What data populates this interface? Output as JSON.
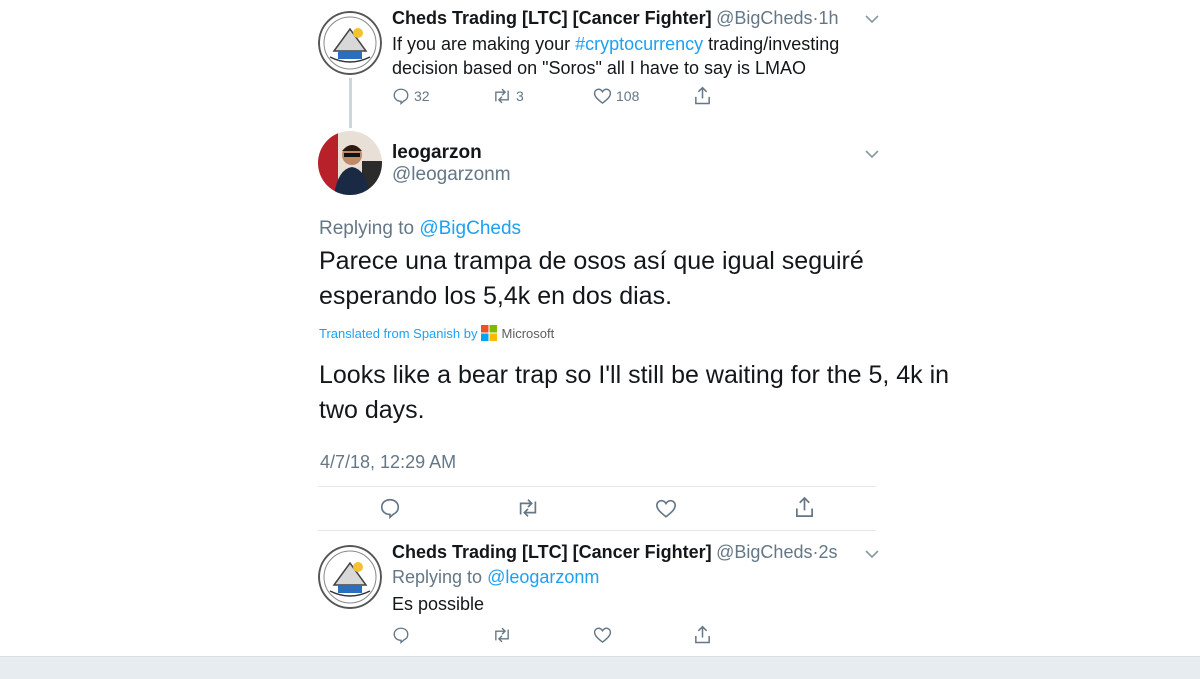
{
  "tweet1": {
    "name": "Cheds Trading [LTC] [Cancer Fighter]",
    "handle": "@BigCheds",
    "sep": "·",
    "time": "1h",
    "text_a": "If you are making your ",
    "hashtag": "#cryptocurrency",
    "text_b": " trading/investing",
    "text_c": "decision based on  \"Soros\" all I have to say is LMAO",
    "replies": "32",
    "retweets": "3",
    "likes": "108"
  },
  "focus_tweet": {
    "name": "leogarzon",
    "handle": "@leogarzonm",
    "replying_label": "Replying to ",
    "replying_to": "@BigCheds",
    "text_line1": "Parece una trampa de osos así que igual seguiré",
    "text_line2": "esperando los 5,4k en dos dias.",
    "translated_label": "Translated from Spanish by",
    "translator": "Microsoft",
    "translation_line1": "Looks like a bear trap so I'll still be waiting for the 5, 4k in",
    "translation_line2": "two days.",
    "timestamp": "4/7/18, 12:29 AM"
  },
  "tweet3": {
    "name": "Cheds Trading [LTC] [Cancer Fighter]",
    "handle": "@BigCheds",
    "sep": "·",
    "time": "2s",
    "replying_label": "Replying to ",
    "replying_to": "@leogarzonm",
    "text": "Es possible"
  },
  "colors": {
    "link": "#1da1f2",
    "secondary": "#657786",
    "text": "#14171a",
    "divider": "#e1e8ed"
  }
}
